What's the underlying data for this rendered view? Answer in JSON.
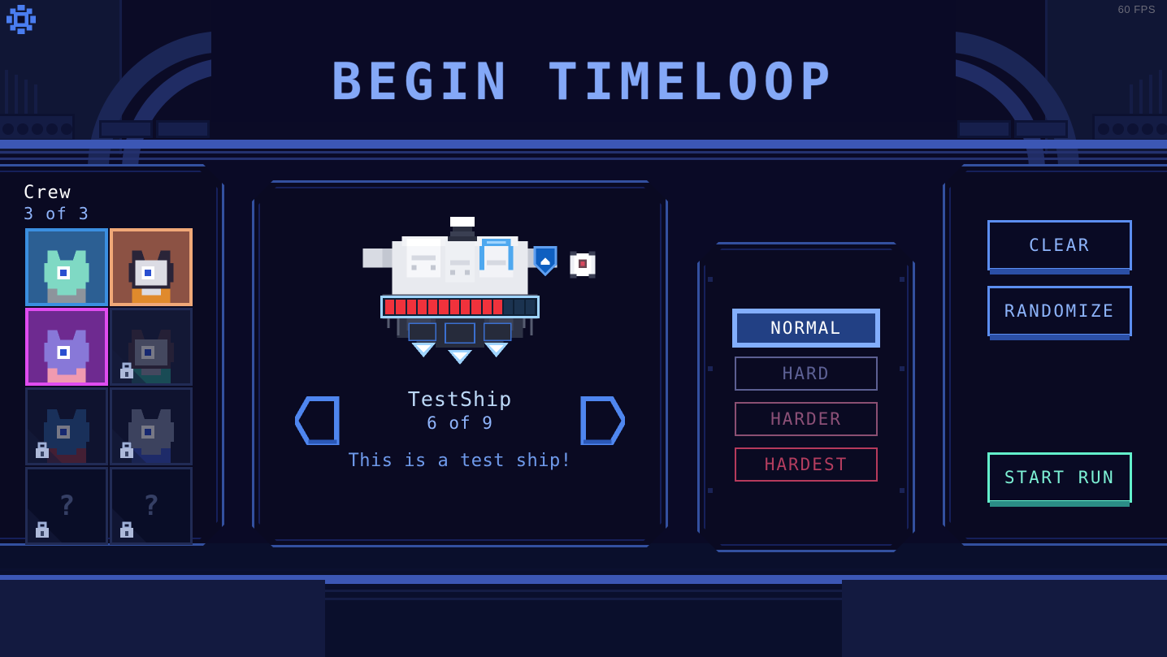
{
  "app": {
    "screen_title": "BEGIN TIMELOOP",
    "fps": "60 FPS",
    "settings_icon": "gear-icon"
  },
  "theme": {
    "bg_dark": "#070720",
    "panel_bg": "#0a0a22",
    "accent_blue": "#84a8f7",
    "accent_border": "#33509f",
    "beam": "#3c57b5",
    "start_green": "#63f0cb",
    "health_red": "#f0323c",
    "normal_fill": "#224084",
    "hard_border": "#5c5f92",
    "harder_border": "#8b4f72",
    "hardest_border": "#b63a5c"
  },
  "crew": {
    "title": "Crew",
    "count_label": "3 of 3",
    "selected": 3,
    "total_slots": 8,
    "slots": [
      {
        "name": "crew-slot-1",
        "state": "selected",
        "locked": false,
        "frame_color": "#3b8fe0",
        "bg": "#2c5f93",
        "portrait": "cat-alien",
        "skin": "#7fd9c4",
        "hair": "#7fd9c4",
        "accent": "#8d949c"
      },
      {
        "name": "crew-slot-2",
        "state": "selected",
        "locked": false,
        "frame_color": "#f0a878",
        "bg": "#8c5244",
        "portrait": "possum",
        "skin": "#dcdce4",
        "hair": "#2a2438",
        "accent": "#e08a2c"
      },
      {
        "name": "crew-slot-3",
        "state": "selected",
        "locked": false,
        "frame_color": "#e04cf0",
        "bg": "#6e2a90",
        "portrait": "dragon",
        "skin": "#8878d8",
        "hair": "#8878d8",
        "accent": "#f09ab0"
      },
      {
        "name": "crew-slot-4",
        "state": "locked",
        "locked": true,
        "frame_color": "#212b55",
        "bg": "#232c4e",
        "portrait": "goat",
        "skin": "#8f96ac",
        "hair": "#4a3c50",
        "accent": "#2f9c96"
      },
      {
        "name": "crew-slot-5",
        "state": "locked",
        "locked": true,
        "frame_color": "#212b55",
        "bg": "#1a2140",
        "portrait": "blue-beast",
        "skin": "#2f5fa0",
        "hair": "#2f5fa0",
        "accent": "#8c3a4c"
      },
      {
        "name": "crew-slot-6",
        "state": "locked",
        "locked": true,
        "frame_color": "#212b55",
        "bg": "#1a2140",
        "portrait": "grey-wolf",
        "skin": "#7d88a8",
        "hair": "#7d88a8",
        "accent": "#3b54c0"
      },
      {
        "name": "crew-slot-7",
        "state": "unknown",
        "locked": true,
        "frame_color": "#212b55",
        "bg": "#0d1330",
        "portrait": "unknown",
        "placeholder": "?"
      },
      {
        "name": "crew-slot-8",
        "state": "unknown",
        "locked": true,
        "frame_color": "#212b55",
        "bg": "#0d1330",
        "portrait": "unknown",
        "placeholder": "?"
      }
    ]
  },
  "ship": {
    "name": "TestShip",
    "index_label": "6 of 9",
    "description": "This is a test ship!",
    "prev_label": "previous-ship",
    "next_label": "next-ship",
    "health": {
      "filled": 11,
      "empty": 4,
      "total": 15
    },
    "badges": [
      {
        "name": "shield-badge",
        "icon": "shield-icon"
      },
      {
        "name": "cargo-badge",
        "icon": "crate-icon"
      }
    ]
  },
  "difficulty": {
    "selected": "NORMAL",
    "options": [
      {
        "label": "NORMAL",
        "state": "active"
      },
      {
        "label": "HARD",
        "state": "locked"
      },
      {
        "label": "HARDER",
        "state": "locked"
      },
      {
        "label": "HARDEST",
        "state": "locked"
      }
    ]
  },
  "actions": {
    "clear": "CLEAR",
    "randomize": "RANDOMIZE",
    "start": "START RUN"
  }
}
